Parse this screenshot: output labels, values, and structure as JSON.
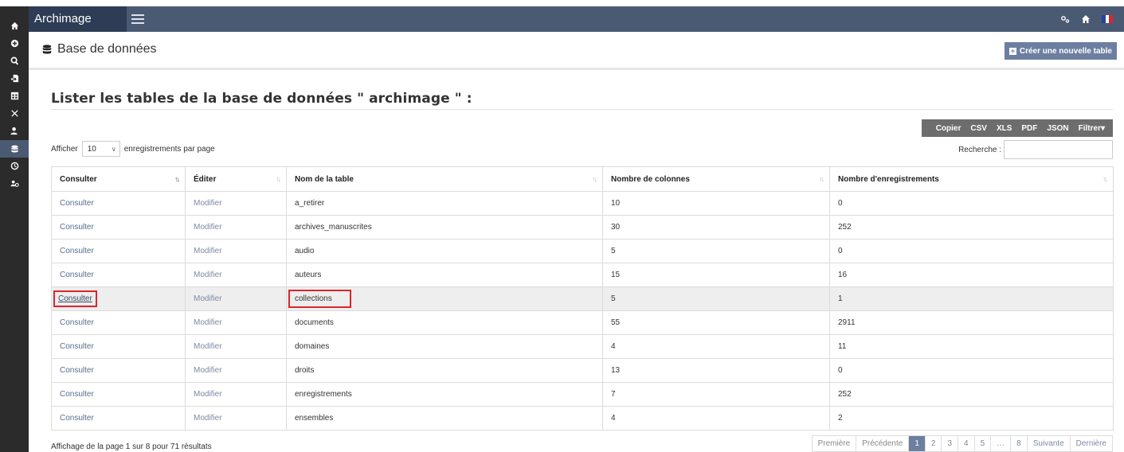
{
  "app": {
    "brand": "Archimage"
  },
  "sidebar": {
    "items": [
      {
        "icon": "home-icon"
      },
      {
        "icon": "plus-circle-icon"
      },
      {
        "icon": "search-icon"
      },
      {
        "icon": "file-import-icon"
      },
      {
        "icon": "table-icon"
      },
      {
        "icon": "tools-icon"
      },
      {
        "icon": "user-edit-icon"
      },
      {
        "icon": "database-icon",
        "active": true
      },
      {
        "icon": "history-icon"
      },
      {
        "icon": "users-cog-icon"
      }
    ]
  },
  "topbar": {
    "icons": [
      "settings-icon",
      "home-icon",
      "french-flag-icon"
    ]
  },
  "header": {
    "title": "Base de données",
    "create_button": "Créer une nouvelle table"
  },
  "section": {
    "title": "Lister les tables de la base de données \" archimage \" :"
  },
  "export_buttons": [
    "Copier",
    "CSV",
    "XLS",
    "PDF",
    "JSON",
    "Filtrer"
  ],
  "length": {
    "prefix": "Afficher",
    "value": "10",
    "suffix": "enregistrements par page"
  },
  "search": {
    "label": "Recherche :",
    "value": ""
  },
  "table": {
    "headers": [
      "Consulter",
      "Éditer",
      "Nom de la table",
      "Nombre de colonnes",
      "Nombre d'enregistrements"
    ],
    "view_label": "Consulter",
    "edit_label": "Modifier",
    "rows": [
      {
        "name": "a_retirer",
        "columns": "10",
        "records": "0"
      },
      {
        "name": "archives_manuscrites",
        "columns": "30",
        "records": "252"
      },
      {
        "name": "audio",
        "columns": "5",
        "records": "0"
      },
      {
        "name": "auteurs",
        "columns": "15",
        "records": "16"
      },
      {
        "name": "collections",
        "columns": "5",
        "records": "1",
        "highlight": true
      },
      {
        "name": "documents",
        "columns": "55",
        "records": "2911"
      },
      {
        "name": "domaines",
        "columns": "4",
        "records": "11"
      },
      {
        "name": "droits",
        "columns": "13",
        "records": "0"
      },
      {
        "name": "enregistrements",
        "columns": "7",
        "records": "252"
      },
      {
        "name": "ensembles",
        "columns": "4",
        "records": "2"
      }
    ]
  },
  "footer": {
    "info": "Affichage de la page 1 sur 8 pour 71 résultats",
    "pagination": [
      "Première",
      "Précédente",
      "1",
      "2",
      "3",
      "4",
      "5",
      "…",
      "8",
      "Suivante",
      "Dernière"
    ],
    "current_page": "1"
  },
  "colors": {
    "navbar": "#4b5a73",
    "brand_bg": "#2e3d55",
    "sidebar": "#2b2b2b",
    "accent": "#6c7fa0",
    "highlight_box": "#d9262c"
  }
}
